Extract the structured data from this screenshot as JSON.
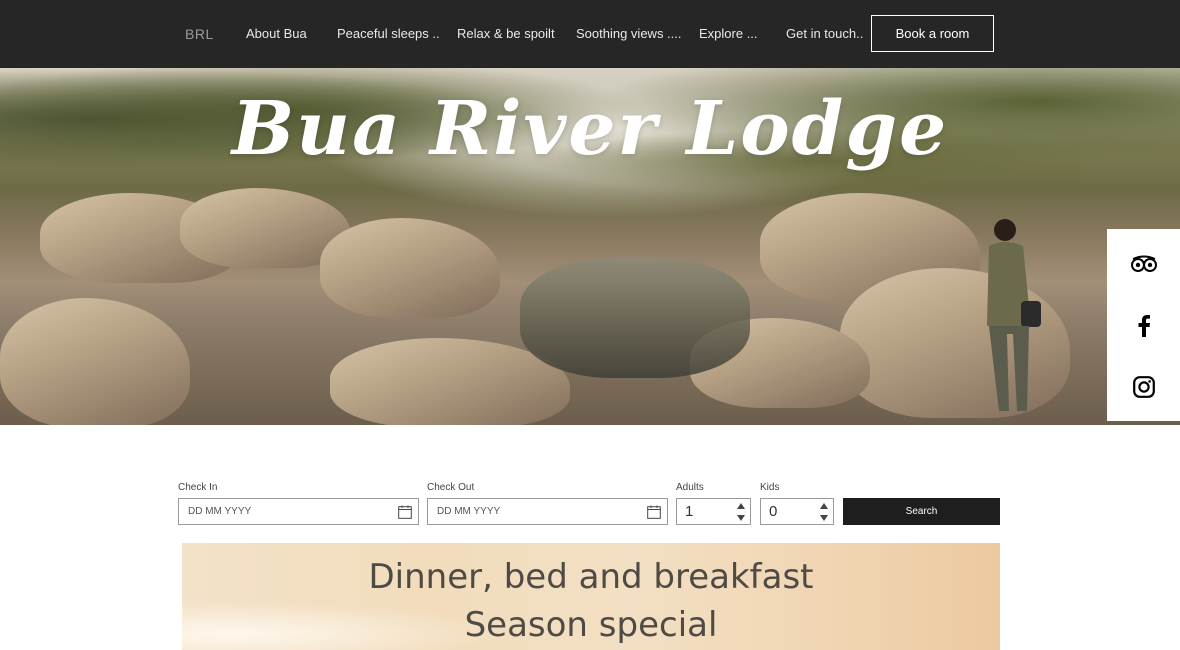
{
  "nav": {
    "logo": "BRL",
    "items": [
      {
        "label": "About Bua"
      },
      {
        "label": "Peaceful sleeps .."
      },
      {
        "label": "Relax & be spoilt"
      },
      {
        "label": "Soothing views ...."
      },
      {
        "label": "Explore ..."
      },
      {
        "label": "Get in touch.."
      }
    ],
    "cta": "Book a room"
  },
  "hero": {
    "title": "Bua River Lodge"
  },
  "social": {
    "items": [
      {
        "icon": "tripadvisor-icon"
      },
      {
        "icon": "facebook-icon"
      },
      {
        "icon": "instagram-icon"
      }
    ]
  },
  "booking": {
    "check_in": {
      "label": "Check In",
      "placeholder": "DD MM YYYY"
    },
    "check_out": {
      "label": "Check Out",
      "placeholder": "DD MM YYYY"
    },
    "adults": {
      "label": "Adults",
      "value": "1"
    },
    "kids": {
      "label": "Kids",
      "value": "0"
    },
    "search_label": "Search"
  },
  "promo": {
    "line1": "Dinner, bed and breakfast",
    "line2": "Season special"
  },
  "colors": {
    "nav_bg": "#262626",
    "search_bg": "#1e1e1e",
    "promo_text": "#4e4a45"
  }
}
